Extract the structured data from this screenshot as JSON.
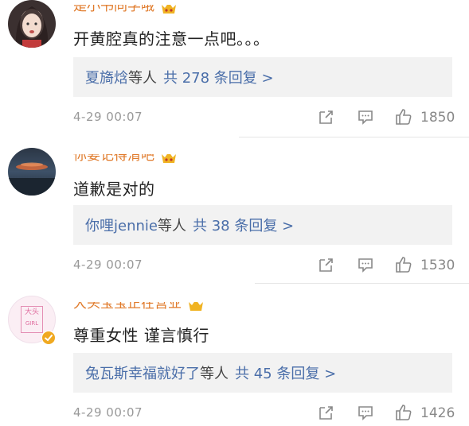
{
  "comments": [
    {
      "username": "是小书同学哦",
      "text": "开黄腔真的注意一点吧。。。",
      "reply_names": "夏旖焓",
      "reply_suffix": "等人",
      "reply_count": "共 278 条回复 >",
      "time": "4-29 00:07",
      "likes": "1850"
    },
    {
      "username": "你要记得清吧",
      "text": "道歉是对的",
      "reply_names": "你哩jennie",
      "reply_suffix": "等人",
      "reply_count": "共 38 条回复 >",
      "time": "4-29 00:07",
      "likes": "1530"
    },
    {
      "username": "大头宝宝正在营业",
      "text": "尊重女性 谨言慎行",
      "reply_names": "兔瓦斯幸福就好了",
      "reply_suffix": "等人",
      "reply_count": "共 45 条回复 >",
      "time": "4-29 00:07",
      "likes": "1426",
      "avatar_text": [
        "大头",
        "GIRL"
      ]
    }
  ],
  "icons": {
    "share": "share-icon",
    "comment": "comment-icon",
    "like": "thumbs-up-icon"
  },
  "colors": {
    "link_blue": "#4a6ea9",
    "username_orange": "#e07a2a",
    "reply_bg": "#f2f2f2"
  }
}
